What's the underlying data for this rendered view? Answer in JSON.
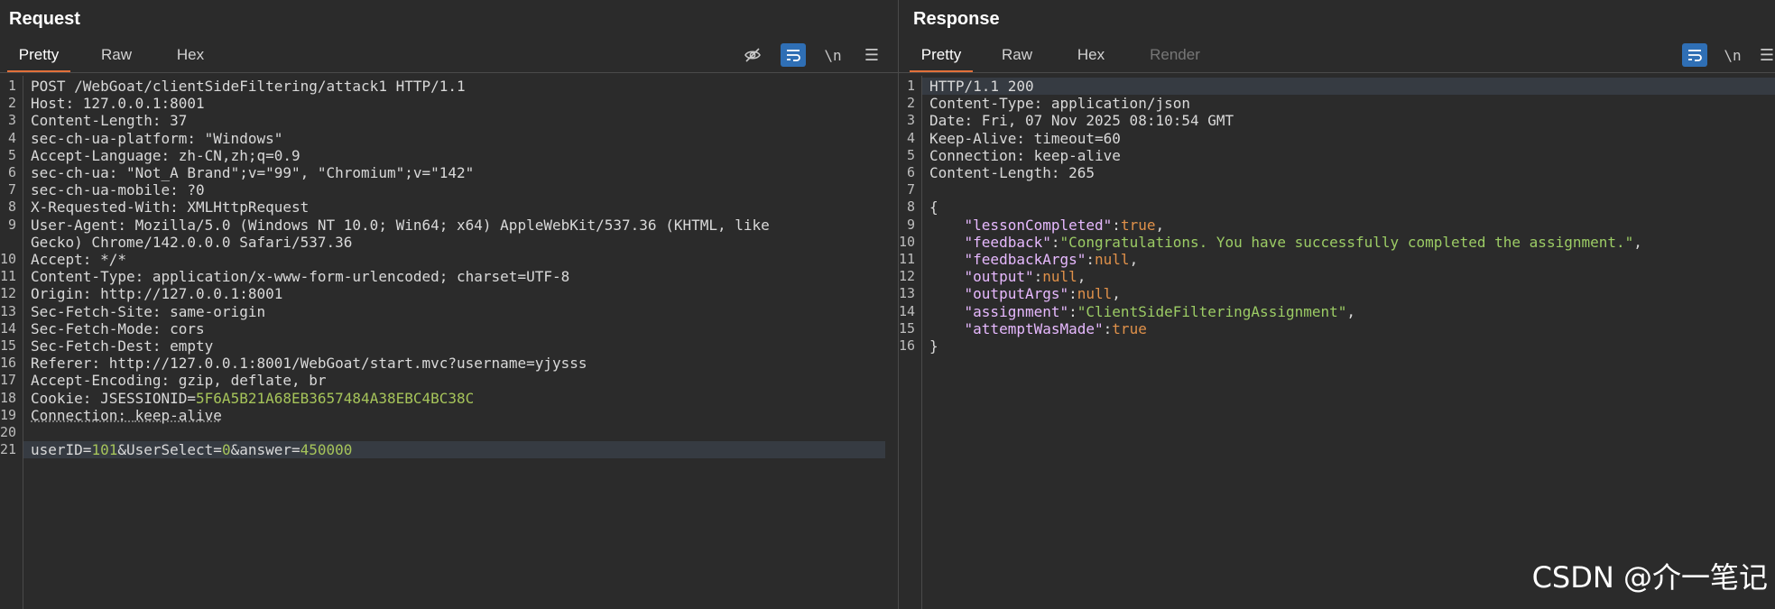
{
  "request": {
    "title": "Request",
    "tabs": [
      "Pretty",
      "Raw",
      "Hex"
    ],
    "active_tab": "Pretty",
    "tools": [
      "eye-off-icon",
      "wrap-icon",
      "\\n",
      "menu-icon"
    ],
    "lines": [
      {
        "n": "1",
        "k": "POST /WebGoat/clientSideFiltering/attack1 HTTP/1.1",
        "v": ""
      },
      {
        "n": "2",
        "k": "Host",
        "v": "127.0.0.1:8001"
      },
      {
        "n": "3",
        "k": "Content-Length",
        "v": "37"
      },
      {
        "n": "4",
        "k": "sec-ch-ua-platform",
        "v": "\"Windows\""
      },
      {
        "n": "5",
        "k": "Accept-Language",
        "v": "zh-CN,zh;q=0.9"
      },
      {
        "n": "6",
        "k": "sec-ch-ua",
        "v": "\"Not_A Brand\";v=\"99\", \"Chromium\";v=\"142\""
      },
      {
        "n": "7",
        "k": "sec-ch-ua-mobile",
        "v": "?0"
      },
      {
        "n": "8",
        "k": "X-Requested-With",
        "v": "XMLHttpRequest"
      },
      {
        "n": "9",
        "k": "User-Agent",
        "v": "Mozilla/5.0 (Windows NT 10.0; Win64; x64) AppleWebKit/537.36 (KHTML, like"
      },
      {
        "n": "",
        "k": "Gecko) Chrome/142.0.0.0 Safari/537.36",
        "v": ""
      },
      {
        "n": "10",
        "k": "Accept",
        "v": "*/*"
      },
      {
        "n": "11",
        "k": "Content-Type",
        "v": "application/x-www-form-urlencoded; charset=UTF-8"
      },
      {
        "n": "12",
        "k": "Origin",
        "v": "http://127.0.0.1:8001"
      },
      {
        "n": "13",
        "k": "Sec-Fetch-Site",
        "v": "same-origin"
      },
      {
        "n": "14",
        "k": "Sec-Fetch-Mode",
        "v": "cors"
      },
      {
        "n": "15",
        "k": "Sec-Fetch-Dest",
        "v": "empty"
      },
      {
        "n": "16",
        "k": "Referer",
        "v": "http://127.0.0.1:8001/WebGoat/start.mvc?username=yjysss"
      },
      {
        "n": "17",
        "k": "Accept-Encoding",
        "v": "gzip, deflate, br"
      },
      {
        "n": "18",
        "k": "Cookie",
        "v": "JSESSIONID=",
        "c": "5F6A5B21A68EB3657484A38EBC4BC38C"
      },
      {
        "n": "19",
        "k": "Connection",
        "v": "keep-alive"
      },
      {
        "n": "20",
        "k": "",
        "v": ""
      },
      {
        "n": "21",
        "body": [
          [
            "userID=",
            ""
          ],
          [
            "101",
            "num"
          ],
          [
            "&UserSelect=",
            ""
          ],
          [
            "0",
            "num"
          ],
          [
            "&answer=",
            ""
          ],
          [
            "450000",
            "num"
          ]
        ]
      }
    ]
  },
  "response": {
    "title": "Response",
    "tabs": [
      "Pretty",
      "Raw",
      "Hex",
      "Render"
    ],
    "active_tab": "Pretty",
    "tools": [
      "wrap-icon",
      "\\n",
      "menu-icon"
    ],
    "lines": [
      {
        "n": "1",
        "k": "HTTP/1.1 200",
        "v": ""
      },
      {
        "n": "2",
        "k": "Content-Type",
        "v": "application/json"
      },
      {
        "n": "3",
        "k": "Date",
        "v": "Fri, 07 Nov 2025 08:10:54 GMT"
      },
      {
        "n": "4",
        "k": "Keep-Alive",
        "v": "timeout=60"
      },
      {
        "n": "5",
        "k": "Connection",
        "v": "keep-alive"
      },
      {
        "n": "6",
        "k": "Content-Length",
        "v": "265"
      },
      {
        "n": "7",
        "k": "",
        "v": ""
      },
      {
        "n": "8",
        "raw": "{"
      },
      {
        "n": "9",
        "jk": "\"lessonCompleted\"",
        "jv": "true",
        "t": "lit",
        "comma": true
      },
      {
        "n": "10",
        "jk": "\"feedback\"",
        "jv": "\"Congratulations. You have successfully completed the assignment.\"",
        "t": "str",
        "comma": true
      },
      {
        "n": "11",
        "jk": "\"feedbackArgs\"",
        "jv": "null",
        "t": "lit",
        "comma": true
      },
      {
        "n": "12",
        "jk": "\"output\"",
        "jv": "null",
        "t": "lit",
        "comma": true
      },
      {
        "n": "13",
        "jk": "\"outputArgs\"",
        "jv": "null",
        "t": "lit",
        "comma": true
      },
      {
        "n": "14",
        "jk": "\"assignment\"",
        "jv": "\"ClientSideFilteringAssignment\"",
        "t": "str",
        "comma": true
      },
      {
        "n": "15",
        "jk": "\"attemptWasMade\"",
        "jv": "true",
        "t": "lit",
        "comma": false
      },
      {
        "n": "16",
        "raw": "}"
      }
    ]
  },
  "watermark": "CSDN @介一笔记",
  "colors": {
    "accent_tab": "#e2703a",
    "tool_on": "#2f6fb5",
    "json_key": "#e7b9ff",
    "json_string": "#9ccc65",
    "json_literal": "#e0914a",
    "number": "#a6c45a"
  }
}
